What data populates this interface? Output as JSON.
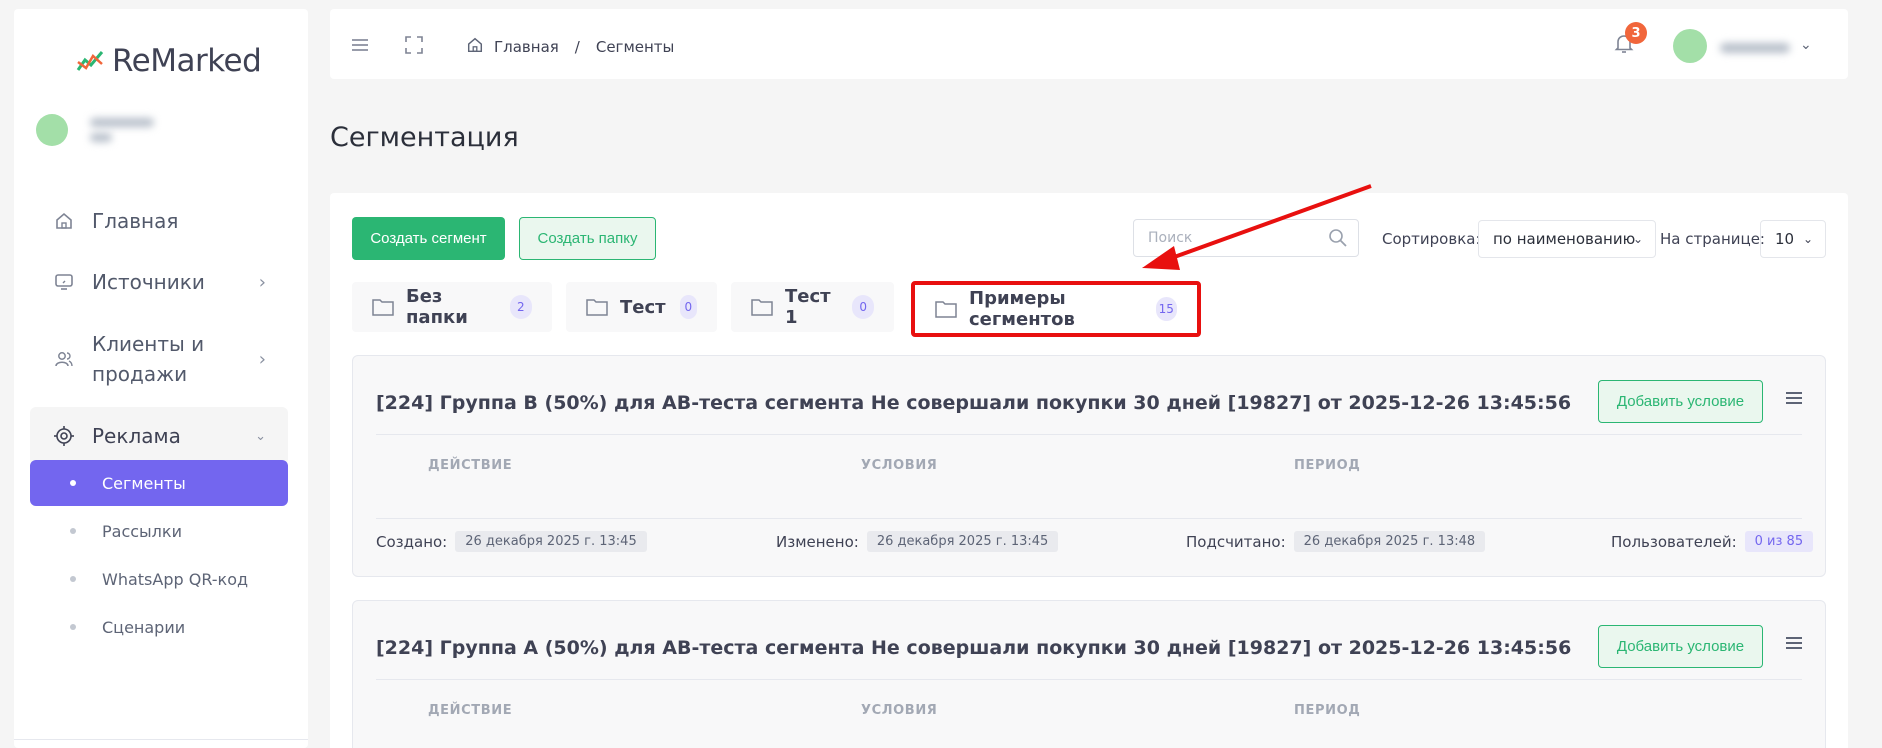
{
  "sidebar": {
    "logo_text": "ReMarked",
    "nav": [
      {
        "label": "Главная",
        "icon": "home-icon"
      },
      {
        "label": "Источники",
        "icon": "monitor-icon"
      },
      {
        "label_line1": "Клиенты и",
        "label_line2": "продажи",
        "icon": "users-icon"
      },
      {
        "label": "Реклама",
        "icon": "target-icon"
      }
    ],
    "sub": [
      {
        "label": "Сегменты",
        "active": true
      },
      {
        "label": "Рассылки"
      },
      {
        "label": "WhatsApp QR-код"
      },
      {
        "label": "Сценарии"
      }
    ]
  },
  "header": {
    "breadcrumb_home": "Главная",
    "breadcrumb_sep": "/",
    "breadcrumb_current": "Сегменты",
    "notifications_count": "3"
  },
  "page": {
    "title": "Сегментация"
  },
  "toolbar": {
    "create_segment": "Создать сегмент",
    "create_folder": "Создать папку",
    "search_placeholder": "Поиск",
    "sort_label": "Сортировка:",
    "sort_value": "по наименованию",
    "per_page_label": "На странице:",
    "per_page_value": "10"
  },
  "folders": [
    {
      "name": "Без папки",
      "count": "2"
    },
    {
      "name": "Тест",
      "count": "0"
    },
    {
      "name": "Тест 1",
      "count": "0"
    },
    {
      "name": "Примеры сегментов",
      "count": "15",
      "highlighted": true
    }
  ],
  "segments": [
    {
      "title": "[224] Группа B (50%) для AB-теста сегмента Не совершали покупки 30 дней [19827] от 2025-12-26 13:45:56",
      "add_condition": "Добавить условие",
      "columns": [
        "ДЕЙСТВИЕ",
        "УСЛОВИЯ",
        "ПЕРИОД"
      ],
      "created_label": "Создано:",
      "created": "26 декабря 2025 г. 13:45",
      "modified_label": "Изменено:",
      "modified": "26 декабря 2025 г. 13:45",
      "counted_label": "Подсчитано:",
      "counted": "26 декабря 2025 г. 13:48",
      "users_label": "Пользователей:",
      "users": "0 из 85"
    },
    {
      "title": "[224] Группа A (50%) для AB-теста сегмента Не совершали покупки 30 дней [19827] от 2025-12-26 13:45:56",
      "add_condition": "Добавить условие",
      "columns": [
        "ДЕЙСТВИЕ",
        "УСЛОВИЯ",
        "ПЕРИОД"
      ]
    }
  ],
  "colors": {
    "accent": "#7366ef",
    "success": "#2bb673",
    "highlight": "#e8100f",
    "badge": "#f1663b"
  }
}
